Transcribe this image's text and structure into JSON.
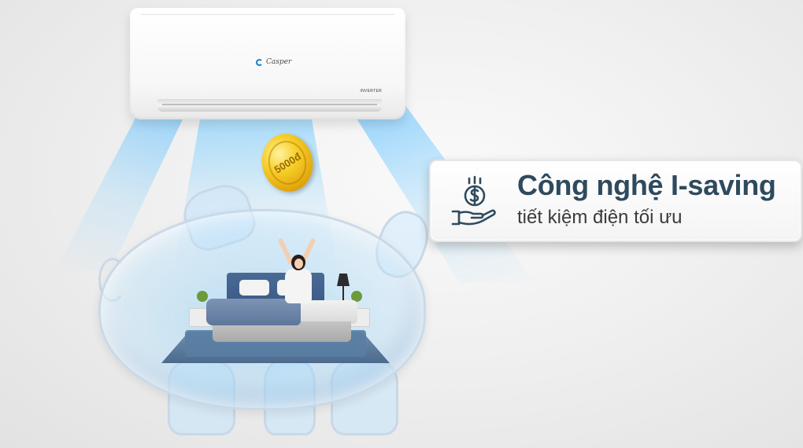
{
  "product": {
    "brand_logo": "Casper",
    "model_badge": "INVERTER"
  },
  "coin": {
    "label": "5000đ"
  },
  "feature": {
    "title": "Công nghệ I-saving",
    "subtitle": "tiết kiệm điện tối ưu",
    "icon": "money-hand-icon",
    "accent_color": "#2e4a5e"
  }
}
